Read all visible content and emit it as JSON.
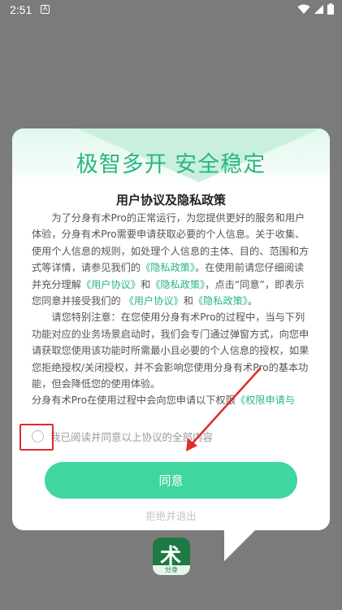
{
  "status_bar": {
    "time": "2:51",
    "notification_letter": "A",
    "icons": [
      "wifi-icon",
      "signal-icon",
      "battery-icon"
    ]
  },
  "dialog": {
    "headline": "极智多开 安全稳定",
    "title": "用户协议及隐私政策",
    "para1": {
      "t1": "为了分身有术Pro的正常运行，为您提供更好的服务和用户体验，分身有术Pro需要申请获取必要的个人信息。关于收集、使用个人信息的规则，如处理个人信息的主体、目的、范围和方式等详情，请参见我们的",
      "l1": "《隐私政策》",
      "t2": "。在使用前请您仔细阅读并充分理解",
      "l2": "《用户协议》",
      "t3": "和",
      "l3": "《隐私政策》",
      "t4": "，点击“同意”，即表示您同意并接受我们的 ",
      "l4": "《用户协议》",
      "t5": "和",
      "l5": "《隐私政策》",
      "t6": "。"
    },
    "para2": "请您特别注意：在您使用分身有术Pro的过程中，当与下列功能对应的业务场景启动时，我们会专门通过弹窗方式，向您申请获取您使用该功能时所需最小且必要的个人信息的授权，如果您拒绝授权/关闭授权，并不会影响您使用分身有术Pro的基本功能，但会降低您的使用体验。",
    "para3": {
      "t1": "分身有术Pro在使用过程中会向您申请以下权限",
      "l1": "《权限申请与"
    },
    "agree_checkbox_label": "我已阅读并同意以上协议的全部内容",
    "agree_button": "同意",
    "reject_link": "拒绝并退出"
  },
  "background_app": {
    "icon_glyph": "术",
    "icon_tag": "分身"
  },
  "colors": {
    "accent": "#3fd6a0",
    "headline": "#2bb681",
    "annotation": "#e02b2b"
  }
}
